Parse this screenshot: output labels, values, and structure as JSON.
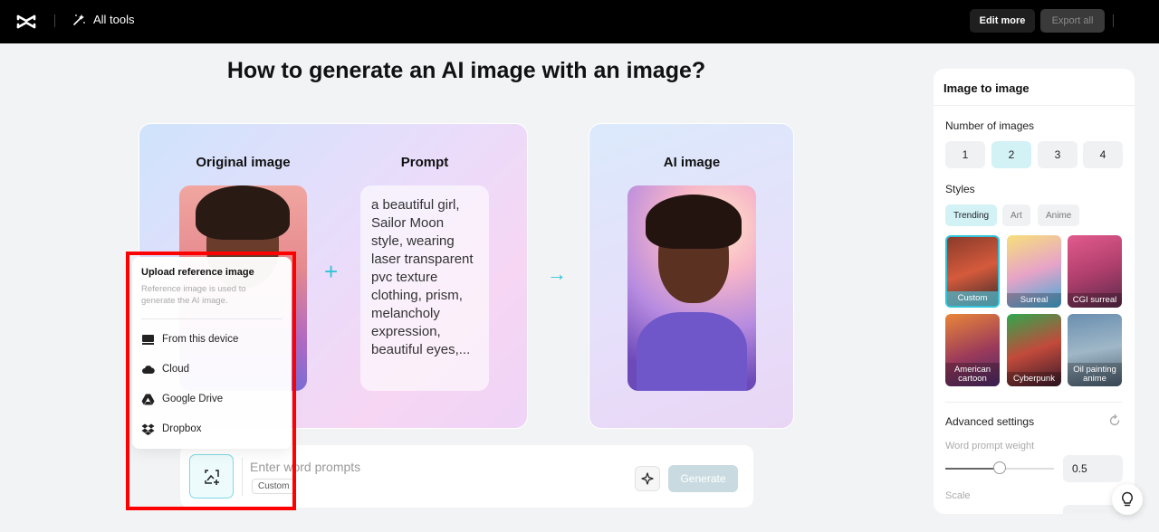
{
  "topbar": {
    "all_tools": "All tools",
    "edit_more": "Edit more",
    "export_all": "Export all"
  },
  "main": {
    "title": "How to generate an AI image with an image?",
    "original_label": "Original image",
    "prompt_label": "Prompt",
    "ai_label": "AI image",
    "prompt_text": "a beautiful girl, Sailor Moon style, wearing laser transparent pvc texture clothing, prism, melancholy expression, beautiful eyes,..."
  },
  "input_bar": {
    "placeholder": "Enter word prompts",
    "tag": "Custom",
    "generate": "Generate"
  },
  "upload_popup": {
    "title": "Upload reference image",
    "description": "Reference image is used to generate the AI image.",
    "items": [
      {
        "label": "From this device",
        "icon": "device-icon"
      },
      {
        "label": "Cloud",
        "icon": "cloud-icon"
      },
      {
        "label": "Google Drive",
        "icon": "google-drive-icon"
      },
      {
        "label": "Dropbox",
        "icon": "dropbox-icon"
      }
    ]
  },
  "panel": {
    "title": "Image to image",
    "num_images_label": "Number of images",
    "num_options": [
      "1",
      "2",
      "3",
      "4"
    ],
    "num_selected": "2",
    "styles_label": "Styles",
    "style_tabs": [
      "Trending",
      "Art",
      "Anime"
    ],
    "style_tab_selected": "Trending",
    "styles": [
      "Custom",
      "Surreal",
      "CGI surreal",
      "American cartoon",
      "Cyberpunk",
      "Oil painting anime"
    ],
    "style_selected": "Custom",
    "advanced_label": "Advanced settings",
    "weight_label": "Word prompt weight",
    "weight_value": "0.5",
    "weight_fraction": 0.5,
    "scale_label": "Scale"
  },
  "colors": {
    "accent": "#33c3d8",
    "selected_bg": "#d3f2f6",
    "highlight_frame": "#ff0000"
  }
}
